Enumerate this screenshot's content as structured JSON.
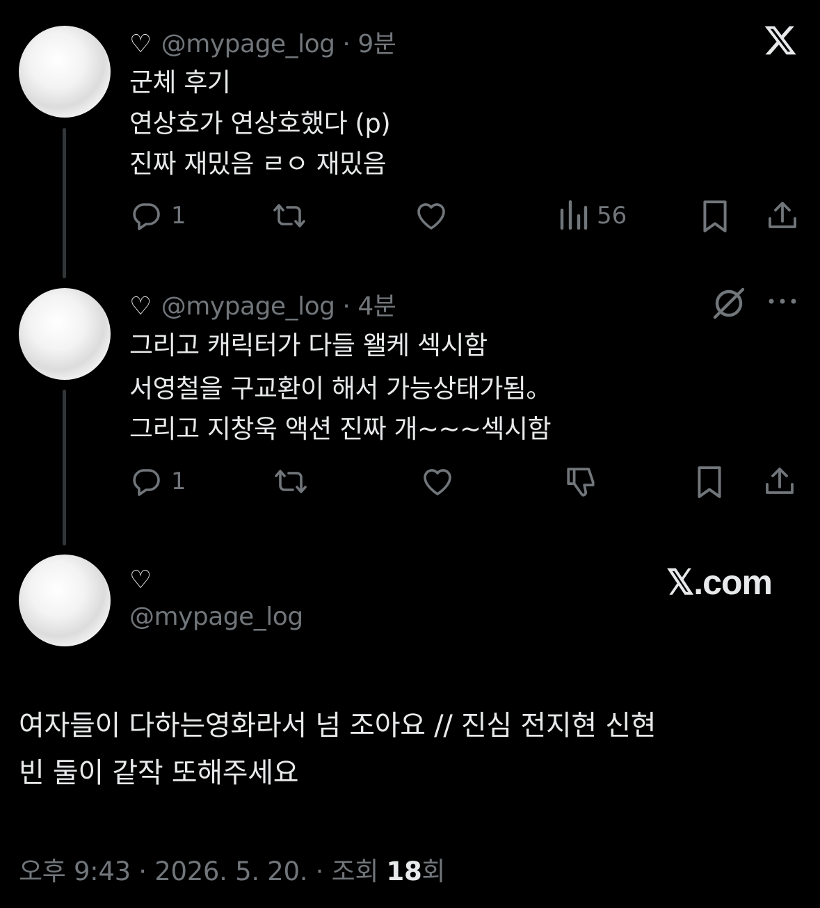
{
  "header": {
    "logo": "x-logo"
  },
  "tweets": [
    {
      "heart": "♡",
      "handle": "@mypage_log",
      "sep": "·",
      "time": "9분",
      "lines": [
        "군체 후기",
        "연상호가 연상호했다 (p)",
        "진짜 재밌음 ㄹㅇ 재밌음"
      ],
      "reply_count": "1",
      "views": "56"
    },
    {
      "heart": "♡",
      "handle": "@mypage_log",
      "sep": "·",
      "time": "4분",
      "lines": [
        "그리고 캐릭터가 다들 왤케 섹시함",
        "서영철을 구교환이 해서 가능상태가됨。",
        "그리고 지창욱 액션 진짜 개~~~섹시함"
      ],
      "reply_count": "1"
    }
  ],
  "main_tweet": {
    "heart": "♡",
    "handle": "@mypage_log",
    "brand": "𝕏.com",
    "lines": [
      "여자들이 다하는영화라서 넘 조아요 // 진심 전지현 신현",
      "빈 둘이 같작 또해주세요"
    ],
    "footer_prefix": "오후 9:43 · 2026. 5. 20. · 조회 ",
    "views_count": "18",
    "views_suffix": "회"
  },
  "icons": {
    "reply": "reply-icon",
    "retweet": "retweet-icon",
    "like": "like-icon",
    "views": "views-icon",
    "bookmark": "bookmark-icon",
    "share": "share-icon",
    "grok": "grok-icon",
    "more": "more-icon",
    "dislike": "dislike-icon"
  },
  "colors": {
    "background": "#000000",
    "text": "#e7e9ea",
    "muted": "#71767b",
    "thread_line": "#333639"
  }
}
